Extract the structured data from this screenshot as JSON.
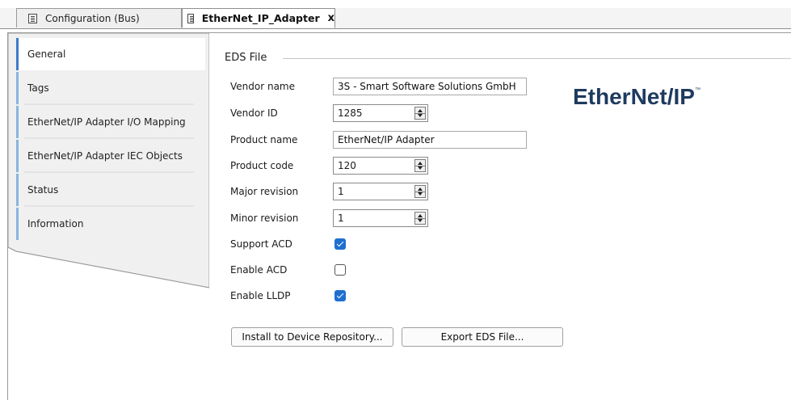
{
  "tabs": [
    {
      "label": "Configuration (Bus)",
      "active": false
    },
    {
      "label": "EtherNet_IP_Adapter",
      "active": true,
      "close": "x"
    }
  ],
  "sidebar": {
    "items": [
      {
        "label": "General",
        "active": true
      },
      {
        "label": "Tags"
      },
      {
        "label": "EtherNet/IP Adapter I/O Mapping"
      },
      {
        "label": "EtherNet/IP Adapter IEC Objects"
      },
      {
        "label": "Status"
      },
      {
        "label": "Information"
      }
    ]
  },
  "eds": {
    "group_title": "EDS File",
    "vendor_name": {
      "label": "Vendor name",
      "value": "3S - Smart Software Solutions GmbH"
    },
    "vendor_id": {
      "label": "Vendor ID",
      "value": "1285"
    },
    "product_name": {
      "label": "Product name",
      "value": "EtherNet/IP Adapter"
    },
    "product_code": {
      "label": "Product code",
      "value": "120"
    },
    "major_revision": {
      "label": "Major revision",
      "value": "1"
    },
    "minor_revision": {
      "label": "Minor revision",
      "value": "1"
    },
    "support_acd": {
      "label": "Support ACD",
      "checked": true
    },
    "enable_acd": {
      "label": "Enable ACD",
      "checked": false
    },
    "enable_lldp": {
      "label": "Enable LLDP",
      "checked": true
    }
  },
  "buttons": {
    "install": "Install to Device Repository...",
    "export": "Export EDS File..."
  },
  "logo": {
    "text": "EtherNet/IP",
    "tm": "™",
    "color": "#1e3a5f"
  },
  "colors": {
    "accent": "#1f6fd1",
    "sidebar_marker": "#8ab4e0"
  }
}
